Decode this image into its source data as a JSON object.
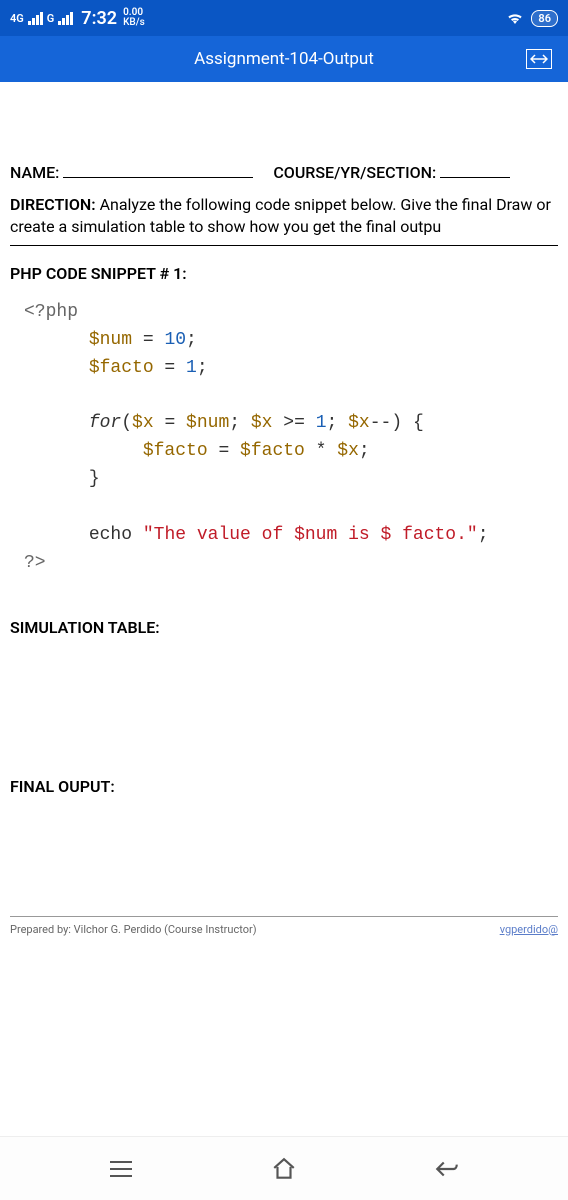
{
  "status": {
    "net1": "4G",
    "net2": "G",
    "time": "7:32",
    "speed_value": "0.00",
    "speed_unit": "KB/s",
    "battery": "86"
  },
  "app": {
    "title": "Assignment-104-Output"
  },
  "doc": {
    "name_label": "NAME:",
    "course_label": "COURSE/YR/SECTION:",
    "direction_label": "DIRECTION:",
    "direction_text": " Analyze the following code snippet below. Give the final Draw or create a simulation table to show how you get the final outpu",
    "code_title": "PHP CODE SNIPPET # 1:",
    "simulation_title": "SIMULATION TABLE:",
    "final_title": "FINAL OUPUT:",
    "footer_left": "Prepared by: Vilchor G. Perdido (Course Instructor)",
    "footer_right": "vgperdido@",
    "code": {
      "l1": "<?php",
      "l2_var": "$num",
      "l2_eq": " = ",
      "l2_val": "10",
      "l3_var": "$facto",
      "l3_eq": " = ",
      "l3_val": "1",
      "for_kw": "for",
      "for_open": "(",
      "for_x": "$x",
      "for_eq": " = ",
      "for_num": "$num",
      "for_sep1": "; ",
      "for_cond": " >= ",
      "for_one": "1",
      "for_sep2": "; ",
      "for_dec": "--) {",
      "body_facto": "$facto",
      "body_eq": " = ",
      "body_mul": " * ",
      "body_x": "$x",
      "close_brace": "}",
      "echo_kw": "echo",
      "echo_str": "\"The value of $num is $ facto.\"",
      "end": "?>"
    }
  }
}
